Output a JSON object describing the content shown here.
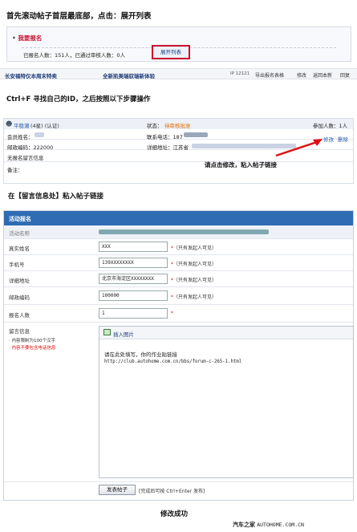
{
  "step1": {
    "title": "首先滚动帖子首层最底部，点击：展开列表",
    "sign_up": "我要报名",
    "stats": "已报名人数：151人，已通过审核人数：0人",
    "expand_button": "展开列表"
  },
  "topbar": {
    "left": "长安福特仅本周末特卖",
    "mid": "全新凯美瑞驭瑞新体验",
    "ip": "IP 12121",
    "links": [
      "导出报名表格",
      "修改",
      "返回本新",
      "回复"
    ]
  },
  "step2": {
    "title": "Ctrl+F 寻找自己的ID，之后按照以下步骤操作",
    "user_name": "平稳潮",
    "user_meta": "(4星) (认证)",
    "status_label": "状态：",
    "status_value": "待审核批准",
    "count_label": "参加人数：1人",
    "member_name_label": "会员姓名：",
    "phone_label": "联系电话：187",
    "zip_label": "邮政编码：222000",
    "address_label": "详细地址：江苏省",
    "edit_link": "修改",
    "delete_link": "删除",
    "no_message": "无报名留言信息",
    "note_label": "备注：",
    "annotation": "请点击修改，粘入帖子链接"
  },
  "step3": {
    "title": "在【留言信息处】粘入帖子链接",
    "form_header": "活动报名",
    "activity_label": "活动名称",
    "name_label": "真实姓名",
    "name_value": "XXX",
    "phone_label": "手机号",
    "phone_value": "139XXXXXXXX",
    "address_label": "详细地址",
    "address_value": "北京市海淀区XXXXXXXX",
    "zip_label": "邮政编码",
    "zip_value": "100000",
    "count_label": "报名人数",
    "count_value": "1",
    "private_hint": "（只有发起人可见）",
    "message_label": "留言信息",
    "message_rule1": "· 内容限制为100个汉字",
    "message_rule2": "· 内容不要包含电话信息",
    "insert_image": "插入图片",
    "message_line1": "请在此处填写，你的作业贴链接",
    "message_line2": "http://club.autohome.com.cn/bbs/forum-c-265-1.html",
    "submit_button": "发表帖子",
    "submit_hint": "[完成后可按 Ctrl+Enter 发布]"
  },
  "footer": {
    "success": "修改成功",
    "watermark_cn": "汽车之家",
    "watermark_en": "AUTOHOME.COM.CN"
  },
  "colors": {
    "form_header_bg": "#2f6cb3",
    "red_box": "#c8102e",
    "link_blue": "#2b5aa8",
    "status_orange": "#e56b00"
  }
}
